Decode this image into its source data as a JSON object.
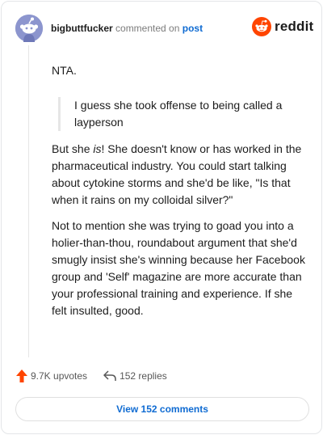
{
  "header": {
    "username": "bigbuttfucker",
    "action_text": "commented on",
    "post_link": "post",
    "brand": "reddit"
  },
  "comment": {
    "line1": "NTA.",
    "quote": "I guess she took offense to being called a layperson",
    "p3_before": "But she ",
    "p3_em": "is",
    "p3_after": "! She doesn't know or has worked in the pharmaceutical industry. You could start talking about cytokine storms and she'd be like, \"Is that when it rains on my colloidal silver?\"",
    "p4": "Not to mention she was trying to goad you into a holier-than-thou, roundabout argument that she'd smugly insist she's winning because her Facebook group and 'Self' magazine are more accurate than your professional training and experience. If she felt insulted, good."
  },
  "actions": {
    "upvotes": "9.7K upvotes",
    "replies": "152 replies",
    "view_button": "View 152 comments"
  },
  "colors": {
    "accent": "#0f6bd2",
    "upvote": "#ff4500",
    "avatar": "#8c95ce",
    "reddit_orange": "#ff4500"
  },
  "icons": {
    "avatar": "snoo-avatar-icon",
    "logo": "reddit-logo-icon",
    "upvote": "upvote-arrow-icon",
    "reply": "reply-arrow-icon"
  }
}
